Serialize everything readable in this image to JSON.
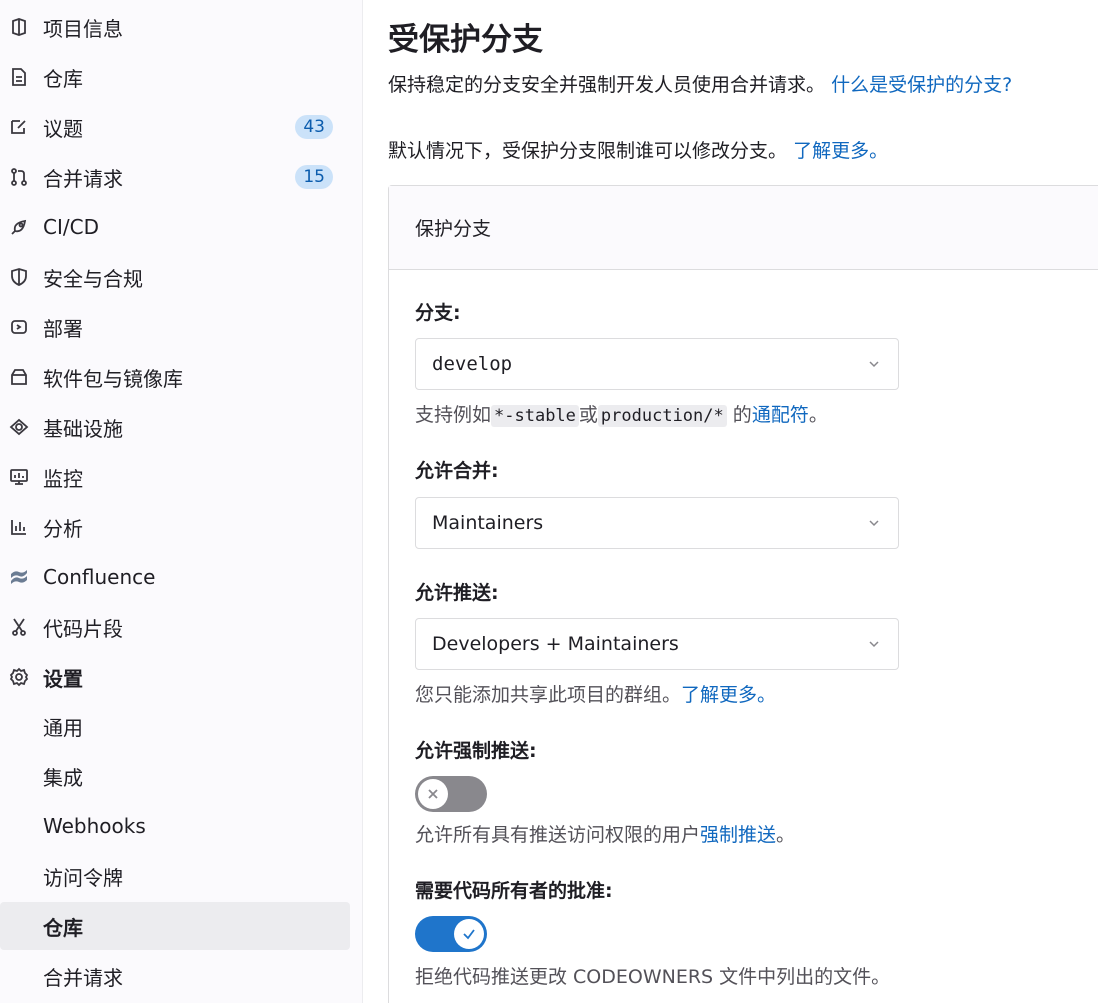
{
  "sidebar": {
    "items": [
      {
        "label": "项目信息",
        "icon": "project-info-icon"
      },
      {
        "label": "仓库",
        "icon": "document-icon"
      },
      {
        "label": "议题",
        "icon": "issues-icon",
        "badge": "43"
      },
      {
        "label": "合并请求",
        "icon": "merge-request-icon",
        "badge": "15"
      },
      {
        "label": "CI/CD",
        "icon": "rocket-icon"
      },
      {
        "label": "安全与合规",
        "icon": "shield-icon"
      },
      {
        "label": "部署",
        "icon": "deploy-icon"
      },
      {
        "label": "软件包与镜像库",
        "icon": "package-icon"
      },
      {
        "label": "基础设施",
        "icon": "infrastructure-icon"
      },
      {
        "label": "监控",
        "icon": "monitor-icon"
      },
      {
        "label": "分析",
        "icon": "analytics-icon"
      },
      {
        "label": "Confluence",
        "icon": "confluence-icon"
      },
      {
        "label": "代码片段",
        "icon": "snippet-icon"
      },
      {
        "label": "设置",
        "icon": "gear-icon"
      }
    ],
    "settings_sub": [
      {
        "label": "通用"
      },
      {
        "label": "集成"
      },
      {
        "label": "Webhooks"
      },
      {
        "label": "访问令牌"
      },
      {
        "label": "仓库",
        "active": true
      },
      {
        "label": "合并请求"
      }
    ]
  },
  "main": {
    "title": "受保护分支",
    "description": "保持稳定的分支安全并强制开发人员使用合并请求。",
    "description_link": "什么是受保护的分支?",
    "default_text": "默认情况下，受保护分支限制谁可以修改分支。",
    "default_link": "了解更多。",
    "card": {
      "header": "保护分支",
      "branch": {
        "label": "分支:",
        "value": "develop",
        "help_prefix": "支持例如",
        "code1": "*-stable",
        "help_or": "或",
        "code2": "production/*",
        "help_mid": "的",
        "help_link": "通配符",
        "help_suffix": "。"
      },
      "allowed_merge": {
        "label": "允许合并:",
        "value": "Maintainers"
      },
      "allowed_push": {
        "label": "允许推送:",
        "value": "Developers + Maintainers",
        "help": "您只能添加共享此项目的群组。",
        "help_link": "了解更多。"
      },
      "force_push": {
        "label": "允许强制推送:",
        "enabled": false,
        "help": "允许所有具有推送访问权限的用户",
        "help_link": "强制推送",
        "help_suffix": "。"
      },
      "code_owner": {
        "label": "需要代码所有者的批准:",
        "enabled": true,
        "help": "拒绝代码推送更改 CODEOWNERS 文件中列出的文件。"
      }
    }
  },
  "colors": {
    "link": "#1068bf",
    "toggle_on": "#1f75cb",
    "toggle_off": "#89888d",
    "badge_bg": "#cbe2f9",
    "badge_text": "#0b5cad"
  }
}
